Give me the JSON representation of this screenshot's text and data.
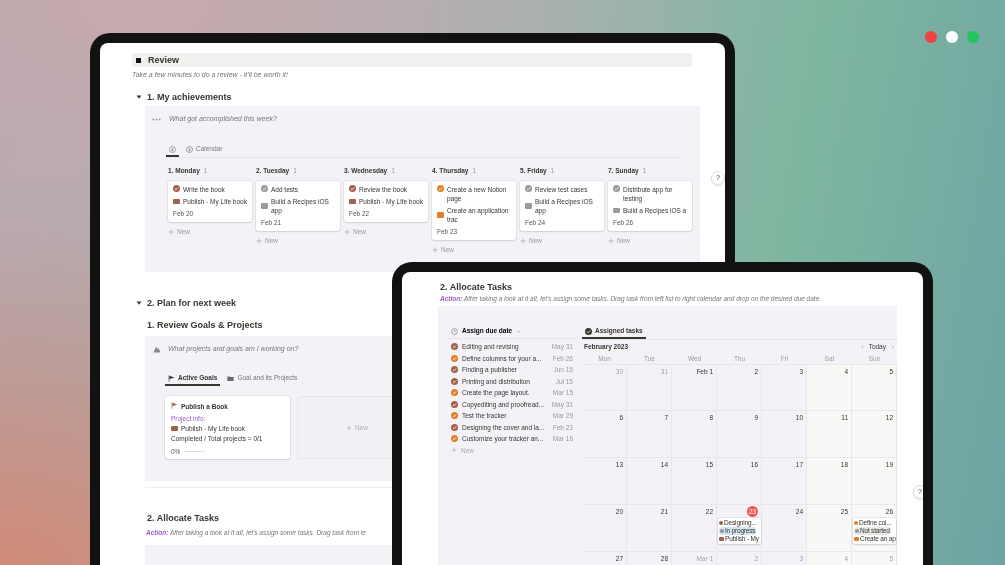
{
  "window_dots": [
    {
      "color": "#ef4444"
    },
    {
      "color": "#ffffff"
    },
    {
      "color": "#22c55e"
    }
  ],
  "back_tablet": {
    "review": {
      "title": "Review",
      "subtitle": "Take a few minutes to do a review - it'll be worth it!"
    },
    "achievements": {
      "heading": "1.  My achievements",
      "expanded": true,
      "prompt": "What got accomplished this week?",
      "tabs": [
        {
          "kind": "icon",
          "selected": true
        },
        {
          "kind": "labelled",
          "label": "Calendar",
          "selected": false
        }
      ],
      "columns": [
        {
          "title": "1. Monday",
          "count": "1",
          "new_label": "New",
          "cards": [
            {
              "title": "Write the book",
              "color": "#a0634a",
              "project": {
                "name": "Publish - My Life book",
                "color": "#a0634a"
              },
              "date": "Feb 20"
            }
          ]
        },
        {
          "title": "2. Tuesday",
          "count": "1",
          "new_label": "New",
          "cards": [
            {
              "title": "Add tests",
              "color": "#9b9a97",
              "project": {
                "name": "Build a Recipes iOS app",
                "color": "#9b9a97"
              },
              "date": "Feb 21"
            }
          ]
        },
        {
          "title": "3. Wednesday",
          "count": "1",
          "new_label": "New",
          "cards": [
            {
              "title": "Review the book",
              "color": "#a0634a",
              "project": {
                "name": "Publish - My Life book",
                "color": "#a0634a"
              },
              "date": "Feb 22"
            }
          ]
        },
        {
          "title": "4. Thursday",
          "count": "1",
          "new_label": "New",
          "cards": [
            {
              "title": "Create a new Notion page",
              "color": "#e0802a",
              "project": {
                "name": "Create an application trac",
                "color": "#e0802a"
              },
              "date": "Feb 23"
            }
          ]
        },
        {
          "title": "5. Friday",
          "count": "1",
          "new_label": "New",
          "cards": [
            {
              "title": "Review test cases",
              "color": "#9b9a97",
              "project": {
                "name": "Build a Recipes iOS app",
                "color": "#9b9a97"
              },
              "date": "Feb 24"
            }
          ]
        },
        {
          "title": "7. Sunday",
          "count": "1",
          "new_label": "New",
          "cards": [
            {
              "title": "Distribute app for testing",
              "color": "#9b9a97",
              "project": {
                "name": "Build a Recipes iOS a",
                "color": "#9b9a97"
              },
              "date": "Feb 26"
            }
          ]
        }
      ]
    },
    "help": "?",
    "plan": {
      "heading": "2.  Plan for next week",
      "expanded": true,
      "goals": {
        "heading": "1.  Review Goals & Projects",
        "prompt": "What projects and goals am I working on?",
        "tabs": [
          {
            "label": "Active Goals",
            "selected": true
          },
          {
            "label": "Goal and its Projects",
            "selected": false
          }
        ],
        "goal_card": {
          "title": "Publish a Book",
          "info_label": "Project info:",
          "project": "Publish - My Life book",
          "summary": "Completed / Total projects = 0/1",
          "progress_label": "0%",
          "level": 0
        },
        "new_label": "New"
      },
      "allocate": {
        "heading": "2. Allocate Tasks",
        "action_label": "Action:",
        "action_text": "After taking a look at it all, let's assign some tasks. Drag task from le"
      }
    }
  },
  "front_tablet": {
    "heading": "2. Allocate Tasks",
    "action_label": "Action:",
    "action_text": "After taking a look at it all, let's assign some tasks. Drag task from left list to right calendar and drop on the desired due date.",
    "list": {
      "title": "Assign due date",
      "new_label": "New",
      "tasks": [
        {
          "title": "Editing and revising",
          "color": "#a0634a",
          "date": "May 31"
        },
        {
          "title": "Define columns for your a...",
          "color": "#e0802a",
          "date": "Feb 26"
        },
        {
          "title": "Finding a publisher",
          "color": "#a0634a",
          "date": "Jun 15"
        },
        {
          "title": "Printing and distribution",
          "color": "#a0634a",
          "date": "Jul 15"
        },
        {
          "title": "Create the page layout.",
          "color": "#e0802a",
          "date": "Mar 15"
        },
        {
          "title": "Copyediting and proofread...",
          "color": "#a0634a",
          "date": "May 31"
        },
        {
          "title": "Test the tracker",
          "color": "#e0802a",
          "date": "Mar 29"
        },
        {
          "title": "Designing the cover and la...",
          "color": "#a0634a",
          "date": "Feb 23"
        },
        {
          "title": "Customize your tracker an...",
          "color": "#e0802a",
          "date": "Mar 16"
        }
      ]
    },
    "calendar": {
      "tab": "Assigned tasks",
      "month": "February 2023",
      "today_label": "Today",
      "weekdays": [
        "Mon",
        "Tue",
        "Wed",
        "Thu",
        "Fri",
        "Sat",
        "Sun"
      ],
      "weeks": [
        [
          {
            "day": "30",
            "muted": true
          },
          {
            "day": "31",
            "muted": true
          },
          {
            "day": "Feb 1",
            "muted": false
          },
          {
            "day": "2",
            "muted": false
          },
          {
            "day": "3",
            "muted": false
          },
          {
            "day": "4",
            "muted": false
          },
          {
            "day": "5",
            "muted": false
          }
        ],
        [
          {
            "day": "6",
            "muted": false
          },
          {
            "day": "7",
            "muted": false
          },
          {
            "day": "8",
            "muted": false
          },
          {
            "day": "9",
            "muted": false
          },
          {
            "day": "10",
            "muted": false
          },
          {
            "day": "11",
            "muted": false
          },
          {
            "day": "12",
            "muted": false
          }
        ],
        [
          {
            "day": "13",
            "muted": false
          },
          {
            "day": "14",
            "muted": false
          },
          {
            "day": "15",
            "muted": false
          },
          {
            "day": "16",
            "muted": false
          },
          {
            "day": "17",
            "muted": false
          },
          {
            "day": "18",
            "muted": false
          },
          {
            "day": "19",
            "muted": false
          }
        ],
        [
          {
            "day": "20",
            "muted": false
          },
          {
            "day": "21",
            "muted": false
          },
          {
            "day": "22",
            "muted": false
          },
          {
            "day": "23",
            "muted": false,
            "today": true,
            "events": [
              {
                "title": "Designing...",
                "color": "#a0634a",
                "status": {
                  "label": "In progress",
                  "color": "#d3e5ef"
                },
                "project": {
                  "name": "Publish - My",
                  "color": "#a0634a"
                }
              }
            ]
          },
          {
            "day": "24",
            "muted": false
          },
          {
            "day": "25",
            "muted": false
          },
          {
            "day": "26",
            "muted": false,
            "events": [
              {
                "title": "Define col...",
                "color": "#e0802a",
                "status": {
                  "label": "Not started",
                  "color": "#e9e8e6"
                },
                "project": {
                  "name": "Create an ap",
                  "color": "#e0802a"
                }
              }
            ]
          }
        ],
        [
          {
            "day": "27",
            "muted": false
          },
          {
            "day": "28",
            "muted": false
          },
          {
            "day": "Mar 1",
            "muted": true
          },
          {
            "day": "2",
            "muted": true
          },
          {
            "day": "3",
            "muted": true
          },
          {
            "day": "4",
            "muted": true
          },
          {
            "day": "5",
            "muted": true
          }
        ]
      ]
    },
    "help": "?"
  }
}
